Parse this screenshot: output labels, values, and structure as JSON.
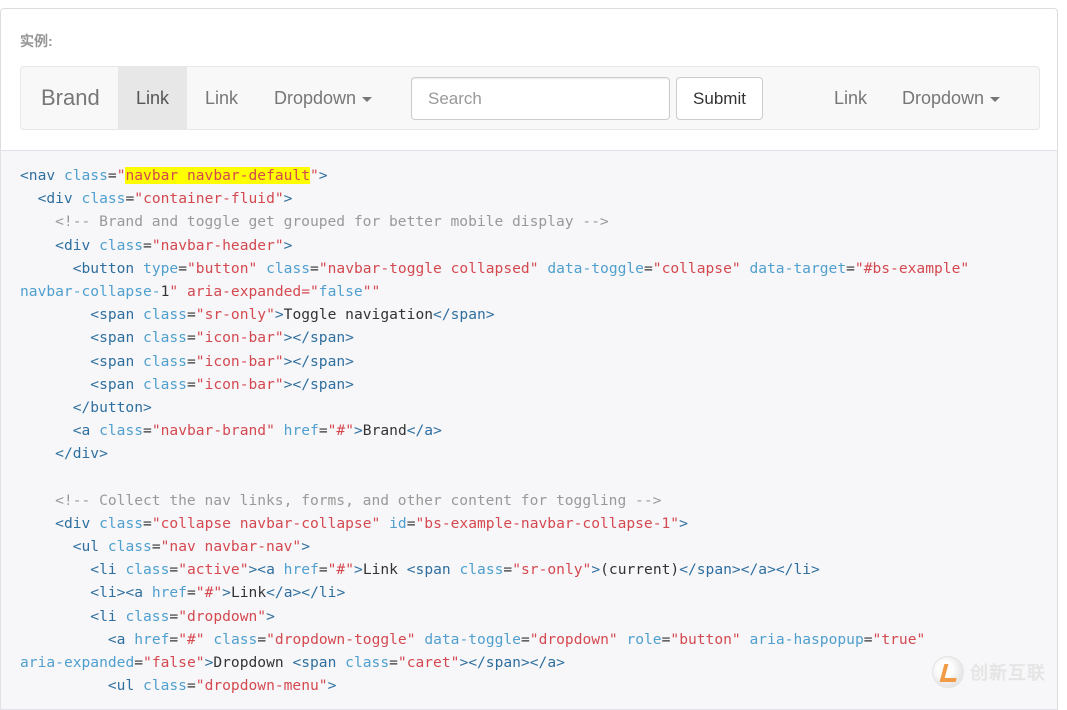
{
  "example": {
    "label": "实例:",
    "navbar": {
      "brand": "Brand",
      "link_active": "Link",
      "link2": "Link",
      "dropdown1": "Dropdown",
      "search_placeholder": "Search",
      "submit": "Submit",
      "link_right": "Link",
      "dropdown2": "Dropdown"
    }
  },
  "code": {
    "lines": [
      "<nav class=\"navbar navbar-default\">",
      "  <div class=\"container-fluid\">",
      "    <!-- Brand and toggle get grouped for better mobile display -->",
      "    <div class=\"navbar-header\">",
      "      <button type=\"button\" class=\"navbar-toggle collapsed\" data-toggle=\"collapse\" data-target=\"#bs-example-",
      "navbar-collapse-1\" aria-expanded=\"false\">",
      "        <span class=\"sr-only\">Toggle navigation</span>",
      "        <span class=\"icon-bar\"></span>",
      "        <span class=\"icon-bar\"></span>",
      "        <span class=\"icon-bar\"></span>",
      "      </button>",
      "      <a class=\"navbar-brand\" href=\"#\">Brand</a>",
      "    </div>",
      "",
      "    <!-- Collect the nav links, forms, and other content for toggling -->",
      "    <div class=\"collapse navbar-collapse\" id=\"bs-example-navbar-collapse-1\">",
      "      <ul class=\"nav navbar-nav\">",
      "        <li class=\"active\"><a href=\"#\">Link <span class=\"sr-only\">(current)</span></a></li>",
      "        <li><a href=\"#\">Link</a></li>",
      "        <li class=\"dropdown\">",
      "          <a href=\"#\" class=\"dropdown-toggle\" data-toggle=\"dropdown\" role=\"button\" aria-haspopup=\"true\"",
      "aria-expanded=\"false\">Dropdown <span class=\"caret\"></span></a>",
      "          <ul class=\"dropdown-menu\">"
    ],
    "highlight": "navbar navbar-default"
  },
  "watermark": {
    "text": "创新互联"
  },
  "colors": {
    "tag": "#2f6f9f",
    "attr": "#4f9fcf",
    "string": "#d44950",
    "comment": "#999999",
    "highlight": "#ffff00"
  }
}
